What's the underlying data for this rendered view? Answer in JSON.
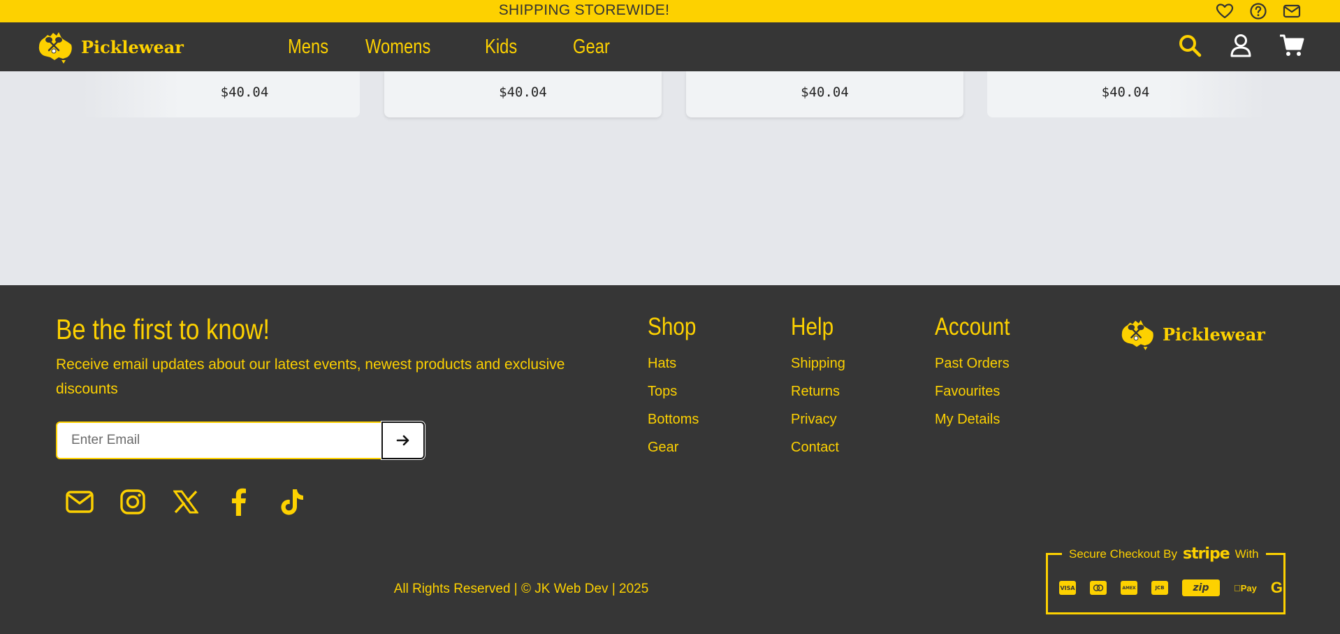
{
  "banner": {
    "text": "SHIPPING STOREWIDE!",
    "icons": [
      "heart-icon",
      "help-circle-icon",
      "mail-icon"
    ]
  },
  "brand": {
    "name": "Picklewear",
    "color": "#fdd100",
    "dark": "#363636"
  },
  "nav": {
    "links": [
      "Mens",
      "Womens",
      "Kids",
      "Gear"
    ],
    "icons": [
      "search-icon",
      "user-icon",
      "cart-icon"
    ]
  },
  "products": [
    {
      "price": "$40.04"
    },
    {
      "price": "$40.04"
    },
    {
      "price": "$40.04"
    },
    {
      "price": "$40.04"
    }
  ],
  "newsletter": {
    "title": "Be the first to know!",
    "description": "Receive email updates about our latest events, newest products and exclusive discounts",
    "placeholder": "Enter Email"
  },
  "socials": [
    "mail-icon",
    "instagram-icon",
    "x-icon",
    "facebook-icon",
    "tiktok-icon"
  ],
  "footer_columns": [
    {
      "title": "Shop",
      "links": [
        "Hats",
        "Tops",
        "Bottoms",
        "Gear"
      ]
    },
    {
      "title": "Help",
      "links": [
        "Shipping",
        "Returns",
        "Privacy",
        "Contact"
      ]
    },
    {
      "title": "Account",
      "links": [
        "Past Orders",
        "Favourites",
        "My Details"
      ]
    }
  ],
  "copyright": "All Rights Reserved | © JK Web Dev | 2025",
  "checkout": {
    "prefix": "Secure Checkout By",
    "provider": "stripe",
    "suffix": "With",
    "methods": [
      "VISA",
      "mastercard",
      "AMEX",
      "JCB",
      "zip",
      "Apple Pay",
      "Google Pay"
    ]
  }
}
